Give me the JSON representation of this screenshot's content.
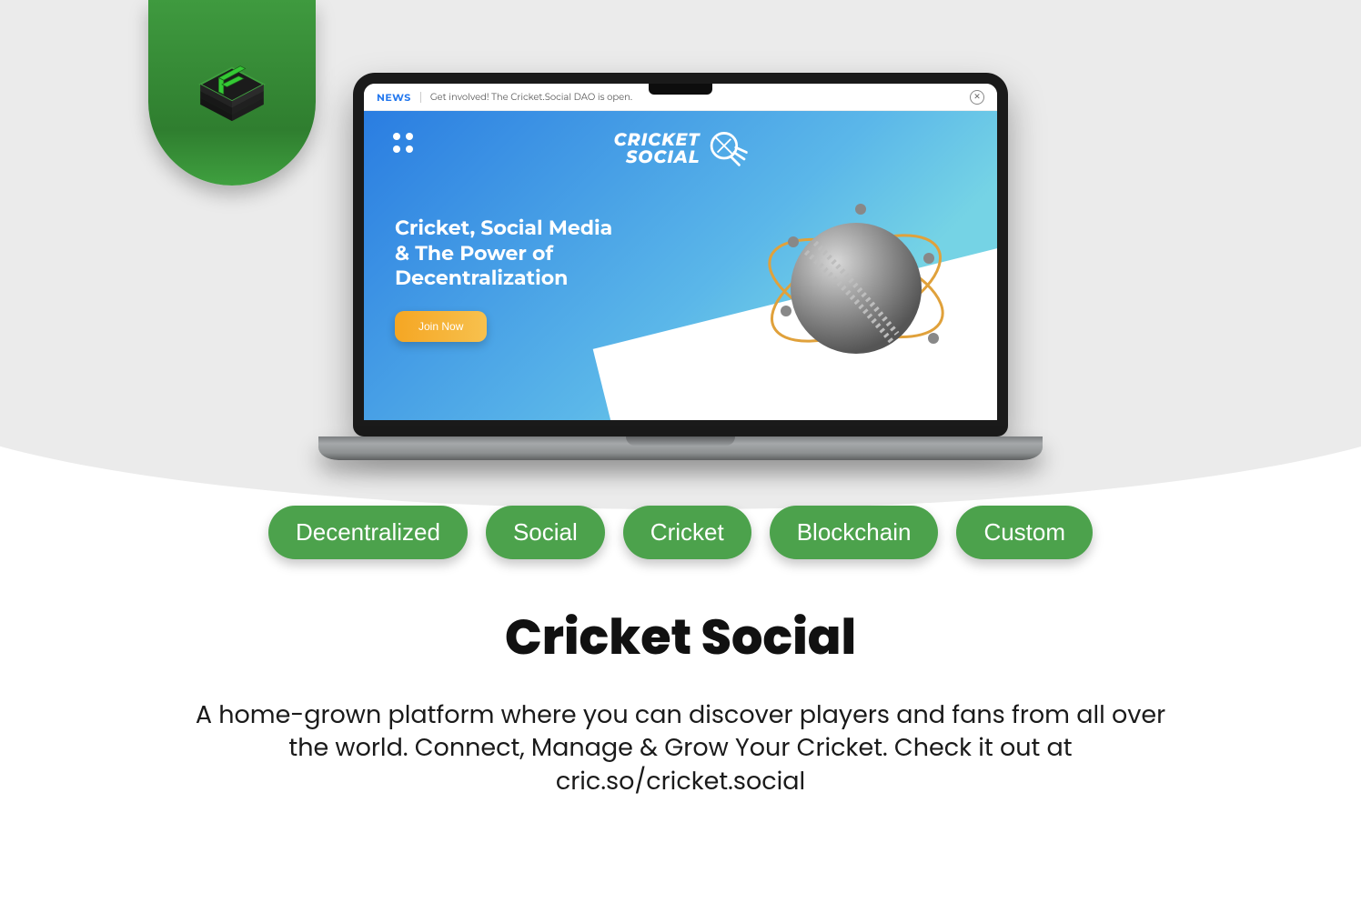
{
  "screen": {
    "news": {
      "label": "NEWS",
      "text": "Get involved! The Cricket.Social DAO is open."
    },
    "brand_line1": "CRICKET",
    "brand_line2": "SOCIAL",
    "hero_heading": "Cricket, Social Media & The Power of Decentralization",
    "cta": "Join Now"
  },
  "tags": [
    "Decentralized",
    "Social",
    "Cricket",
    "Blockchain",
    "Custom"
  ],
  "title": "Cricket Social",
  "description": "A home-grown platform where you can discover players and fans from all over the world. Connect, Manage & Grow Your Cricket. Check it out at cric.so/cricket.social"
}
